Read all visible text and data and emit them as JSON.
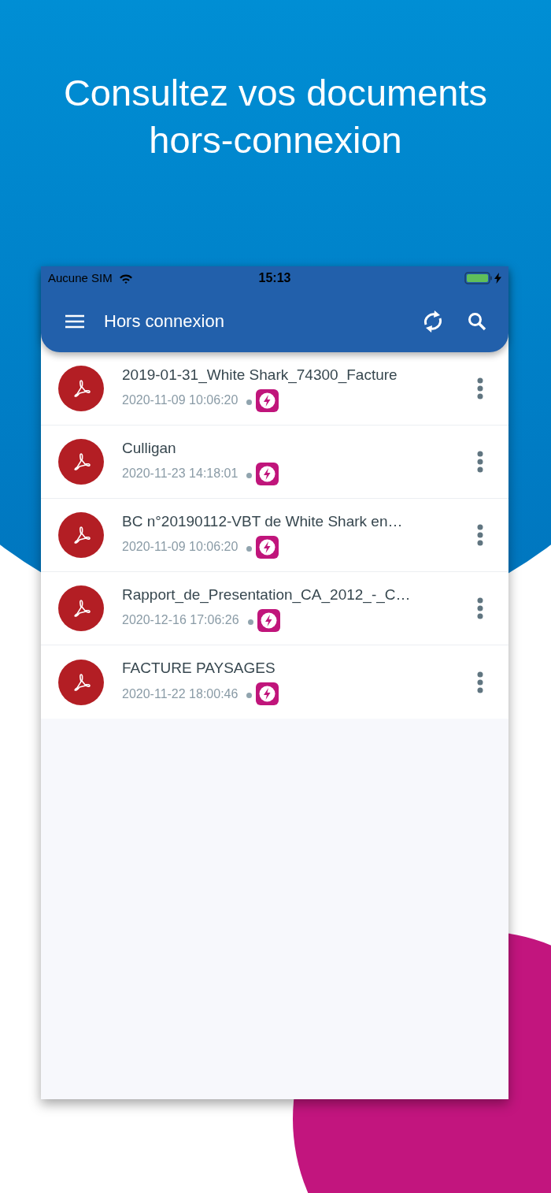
{
  "headline": [
    "Consultez vos documents",
    "hors-connexion"
  ],
  "status_bar": {
    "carrier": "Aucune SIM",
    "time": "15:13"
  },
  "app_bar": {
    "title": "Hors connexion"
  },
  "documents": [
    {
      "title": "2019-01-31_White Shark_74300_Facture",
      "date": "2020-11-09 10:06:20"
    },
    {
      "title": "Culligan",
      "date": "2020-11-23 14:18:01"
    },
    {
      "title": "BC n°20190112-VBT de White Shark en…",
      "date": "2020-11-09 10:06:20"
    },
    {
      "title": "Rapport_de_Presentation_CA_2012_-_C…",
      "date": "2020-12-16 17:06:26"
    },
    {
      "title": "FACTURE PAYSAGES",
      "date": "2020-11-22 18:00:46"
    }
  ]
}
